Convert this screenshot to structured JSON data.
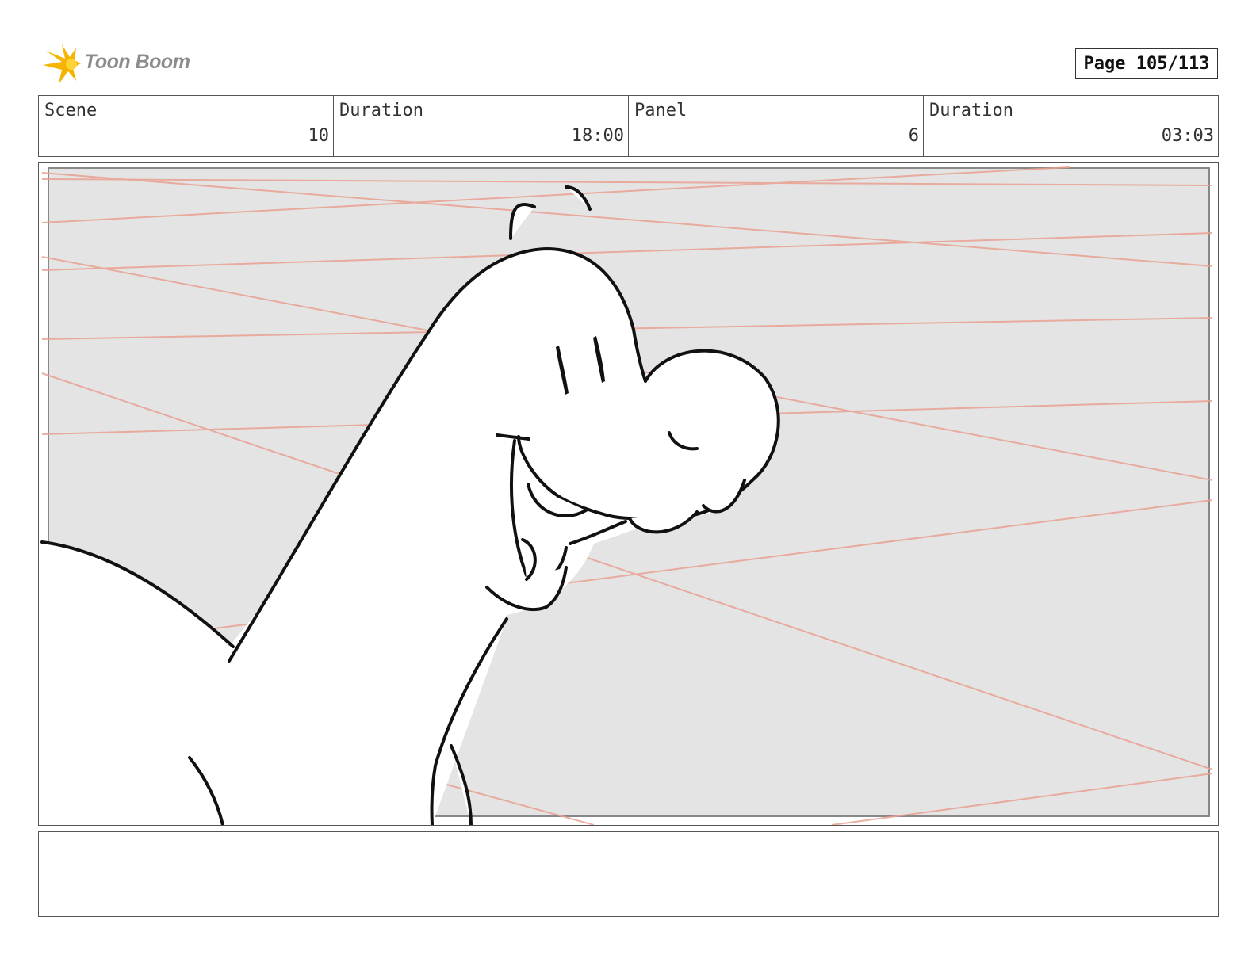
{
  "header": {
    "logo_text": "Toon Boom",
    "page_label": "Page 105/113"
  },
  "info": {
    "scene_label": "Scene",
    "scene_value": "10",
    "scene_duration_label": "Duration",
    "scene_duration_value": "18:00",
    "panel_label": "Panel",
    "panel_value": "6",
    "panel_duration_label": "Duration",
    "panel_duration_value": "03:03"
  },
  "panel": {
    "background_color": "#e4e4e4",
    "guide_line_color": "#e8a090",
    "content": "dinosaur-sketch"
  },
  "caption": {
    "text": ""
  }
}
